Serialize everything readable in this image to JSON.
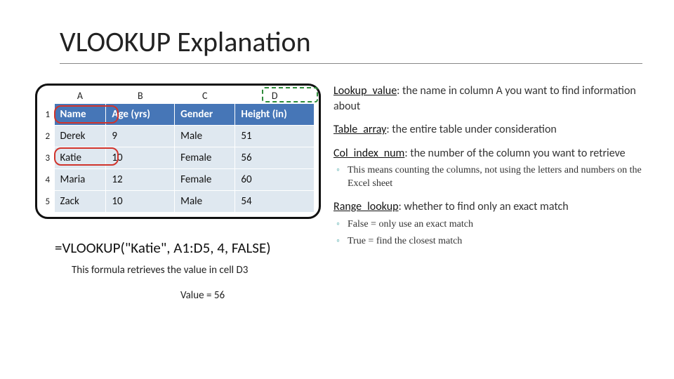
{
  "title": "VLOOKUP Explanation",
  "col_letters": [
    "A",
    "B",
    "C",
    "D"
  ],
  "headers": [
    "Name",
    "Age (yrs)",
    "Gender",
    "Height (in)"
  ],
  "rows": [
    [
      "Derek",
      "9",
      "Male",
      "51"
    ],
    [
      "Katie",
      "10",
      "Female",
      "56"
    ],
    [
      "Maria",
      "12",
      "Female",
      "60"
    ],
    [
      "Zack",
      "10",
      "Male",
      "54"
    ]
  ],
  "row_nums": [
    "1",
    "2",
    "3",
    "4",
    "5"
  ],
  "formula": "=VLOOKUP(\"Katie\", A1:D5, 4, FALSE)",
  "caption": "This formula retrieves the value in cell D3",
  "result": "Value = 56",
  "defs": {
    "lv": {
      "term": "Lookup_value",
      "text": ": the name in column A you want to find information about"
    },
    "ta": {
      "term": "Table_array",
      "text": ": the entire table under consideration"
    },
    "ci": {
      "term": "Col_index_num",
      "text": ": the number of the column you want to retrieve",
      "sub": "This means counting the columns, not using the letters and numbers on the Excel sheet"
    },
    "rl": {
      "term": "Range_lookup",
      "text": ": whether to find only an exact match",
      "sub1": "False = only use an exact match",
      "sub2": "True = find the closest match"
    }
  },
  "chart_data": {
    "type": "table",
    "columns": [
      "Name",
      "Age (yrs)",
      "Gender",
      "Height (in)"
    ],
    "rows": [
      {
        "Name": "Derek",
        "Age (yrs)": 9,
        "Gender": "Male",
        "Height (in)": 51
      },
      {
        "Name": "Katie",
        "Age (yrs)": 10,
        "Gender": "Female",
        "Height (in)": 56
      },
      {
        "Name": "Maria",
        "Age (yrs)": 12,
        "Gender": "Female",
        "Height (in)": 60
      },
      {
        "Name": "Zack",
        "Age (yrs)": 10,
        "Gender": "Male",
        "Height (in)": 54
      }
    ],
    "title": "VLOOKUP sample data",
    "formula": "=VLOOKUP(\"Katie\", A1:D5, 4, FALSE)",
    "result_cell": "D3",
    "result_value": 56
  }
}
